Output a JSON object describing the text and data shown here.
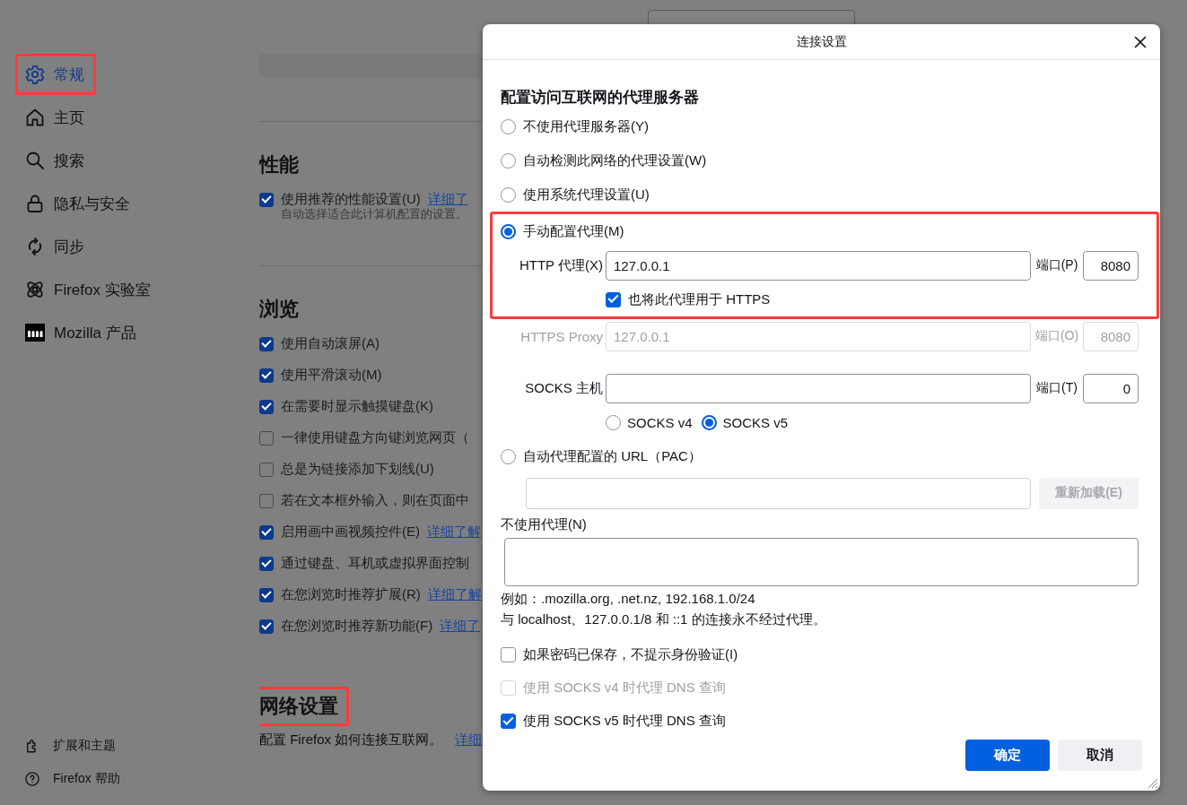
{
  "sidebar": {
    "items": [
      {
        "label": "常规",
        "selected": true,
        "highlighted": true
      },
      {
        "label": "主页",
        "selected": false,
        "highlighted": false
      },
      {
        "label": "搜索",
        "selected": false,
        "highlighted": false
      },
      {
        "label": "隐私与安全",
        "selected": false,
        "highlighted": false
      },
      {
        "label": "同步",
        "selected": false,
        "highlighted": false
      },
      {
        "label": "Firefox 实验室",
        "selected": false,
        "highlighted": false
      },
      {
        "label": "Mozilla 产品",
        "selected": false,
        "highlighted": false
      }
    ],
    "footer_items": [
      {
        "label": "扩展和主题"
      },
      {
        "label": "Firefox 帮助"
      }
    ]
  },
  "sections": [
    {
      "heading": "性能",
      "highlighted": false,
      "options": [
        {
          "label": "使用推荐的性能设置(U)",
          "checked": true,
          "link": "详细了",
          "description": "自动选择适合此计算机配置的设置。"
        }
      ]
    },
    {
      "heading": "浏览",
      "highlighted": false,
      "options": [
        {
          "label": "使用自动滚屏(A)",
          "checked": true
        },
        {
          "label": "使用平滑滚动(M)",
          "checked": true
        },
        {
          "label": "在需要时显示触摸键盘(K)",
          "checked": true
        },
        {
          "label": "一律使用键盘方向键浏览网页（",
          "checked": false
        },
        {
          "label": "总是为链接添加下划线(U)",
          "checked": false
        },
        {
          "label": "若在文本框外输入，则在页面中",
          "checked": false
        },
        {
          "label": "启用画中画视频控件(E)",
          "checked": true,
          "link": "详细了解"
        },
        {
          "label": "通过键盘、耳机或虚拟界面控制",
          "checked": true
        },
        {
          "label": "在您浏览时推荐扩展(R)",
          "checked": true,
          "link": "详细了解"
        },
        {
          "label": "在您浏览时推荐新功能(F)",
          "checked": true,
          "link": "详细了"
        }
      ]
    },
    {
      "heading": "网络设置",
      "highlighted": true,
      "text": "配置 Firefox 如何连接互联网。",
      "link": "详细"
    }
  ],
  "dialog": {
    "title": "连接设置",
    "heading": "配置访问互联网的代理服务器",
    "modes": [
      {
        "label": "不使用代理服务器(Y)",
        "selected": false
      },
      {
        "label": "自动检测此网络的代理设置(W)",
        "selected": false
      },
      {
        "label": "使用系统代理设置(U)",
        "selected": false
      },
      {
        "label": "手动配置代理(M)",
        "selected": true
      }
    ],
    "manual_highlighted": true,
    "http": {
      "label": "HTTP 代理(X)",
      "value": "127.0.0.1",
      "port_label": "端口(P)",
      "port": "8080",
      "disabled": false
    },
    "share_https": {
      "label": "也将此代理用于 HTTPS",
      "checked": true
    },
    "https": {
      "label": "HTTPS Proxy",
      "value": "127.0.0.1",
      "port_label": "端口(O)",
      "port": "8080",
      "disabled": true
    },
    "socks": {
      "label": "SOCKS 主机",
      "port_label": "端口(T)",
      "port": "0",
      "disabled": false
    },
    "socks_versions": [
      {
        "label": "SOCKS v4",
        "selected": false
      },
      {
        "label": "SOCKS v5",
        "selected": true
      }
    ],
    "pac": {
      "label": "自动代理配置的 URL（PAC）",
      "selected": false,
      "reload": {
        "label": "重新加载(E)",
        "disabled": true
      }
    },
    "no_proxy_label": "不使用代理(N)",
    "notes": [
      "例如：.mozilla.org, .net.nz, 192.168.1.0/24",
      "与 localhost、127.0.0.1/8 和 ::1 的连接永不经过代理。"
    ],
    "checkboxes": [
      {
        "label": "如果密码已保存，不提示身份验证(I)",
        "checked": false,
        "disabled": false
      },
      {
        "label": "使用 SOCKS v4 时代理 DNS 查询",
        "checked": false,
        "disabled": true
      },
      {
        "label": "使用 SOCKS v5 时代理 DNS 查询",
        "checked": true,
        "disabled": false
      }
    ],
    "buttons": [
      {
        "label": "确定",
        "kind": "primary"
      },
      {
        "label": "取消",
        "kind": "secondary"
      }
    ]
  }
}
